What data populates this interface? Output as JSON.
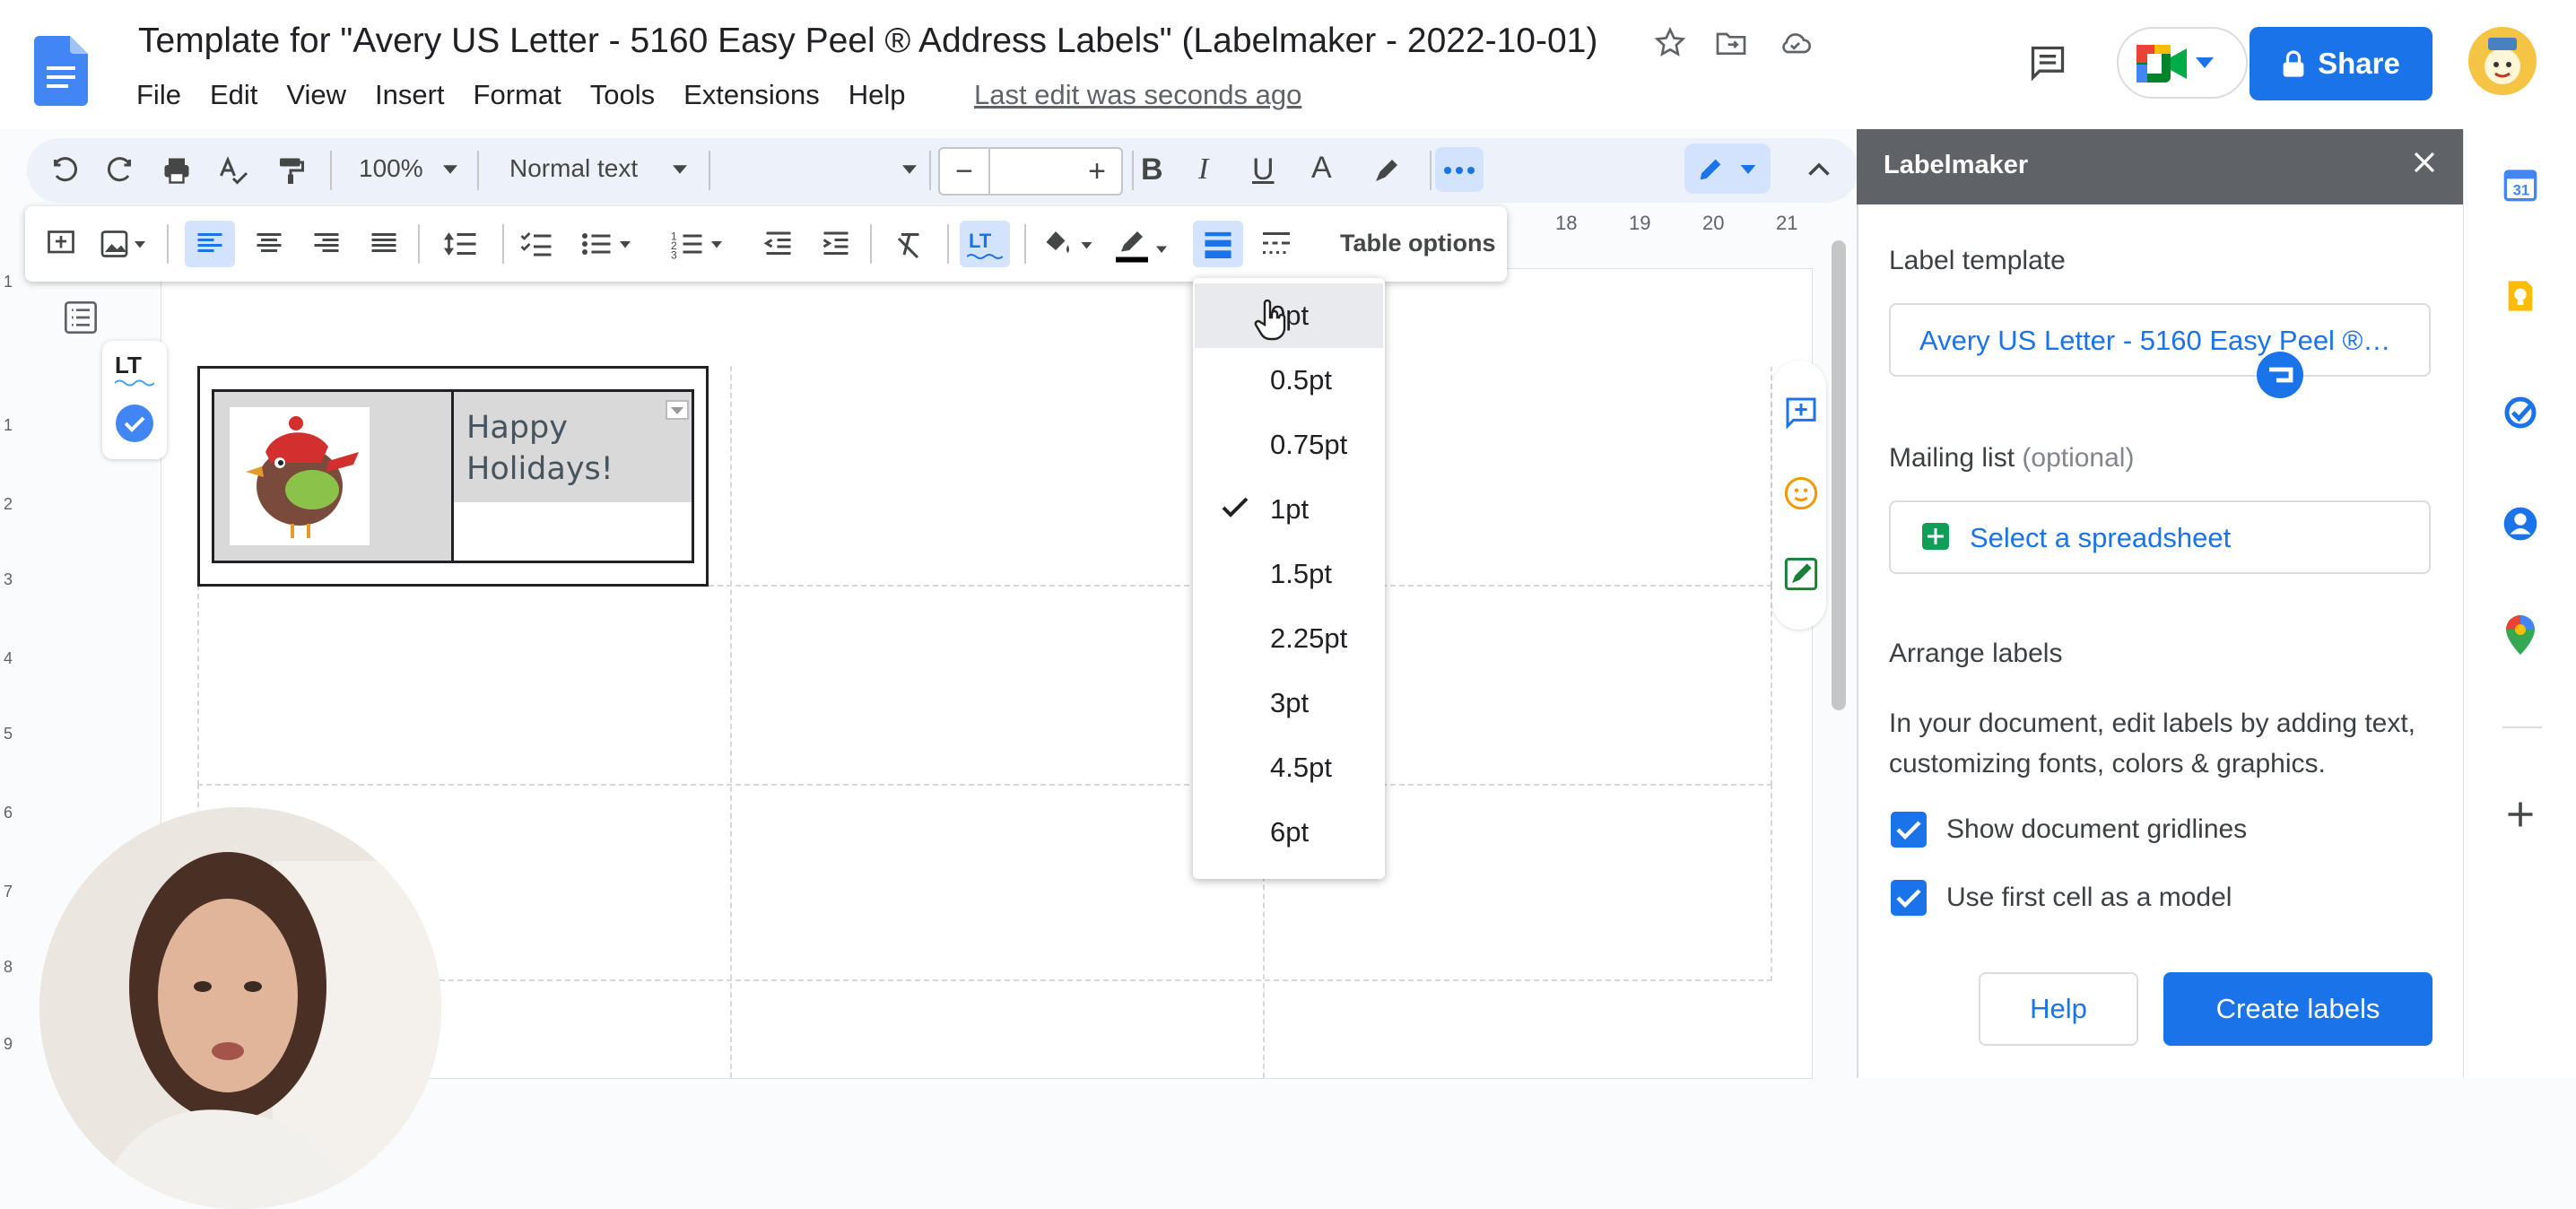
{
  "header": {
    "title": "Template for \"Avery US Letter - 5160 Easy Peel ® Address Labels\" (Labelmaker - 2022-10-01)",
    "menu": [
      "File",
      "Edit",
      "View",
      "Insert",
      "Format",
      "Tools",
      "Extensions",
      "Help"
    ],
    "last_edit": "Last edit was seconds ago",
    "share_label": "Share"
  },
  "toolbar": {
    "zoom": "100%",
    "style": "Normal text",
    "font_size": "",
    "table_options": "Table options"
  },
  "ruler": [
    "18",
    "19",
    "20",
    "21"
  ],
  "document": {
    "label_text_line1": "Happy",
    "label_text_line2": "Holidays!"
  },
  "dropdown": {
    "items": [
      "0pt",
      "0.5pt",
      "0.75pt",
      "1pt",
      "1.5pt",
      "2.25pt",
      "3pt",
      "4.5pt",
      "6pt"
    ],
    "selected": "1pt"
  },
  "panel": {
    "title": "Labelmaker",
    "label_template_heading": "Label template",
    "label_template_value": "Avery US Letter - 5160 Easy Peel ®…",
    "mailing_list_heading": "Mailing list",
    "mailing_list_optional": "(optional)",
    "spreadsheet_button": "Select a spreadsheet",
    "arrange_heading": "Arrange labels",
    "arrange_desc": "In your document, edit labels by adding text, customizing fonts, colors & graphics.",
    "gridlines_label": "Show document gridlines",
    "gridlines_checked": true,
    "first_cell_label": "Use first cell as a model",
    "first_cell_checked": true,
    "help_button": "Help",
    "create_button": "Create labels"
  },
  "colors": {
    "accent": "#1a73e8",
    "panel_header": "#5f6368",
    "label_fill": "#d9d9d9"
  }
}
